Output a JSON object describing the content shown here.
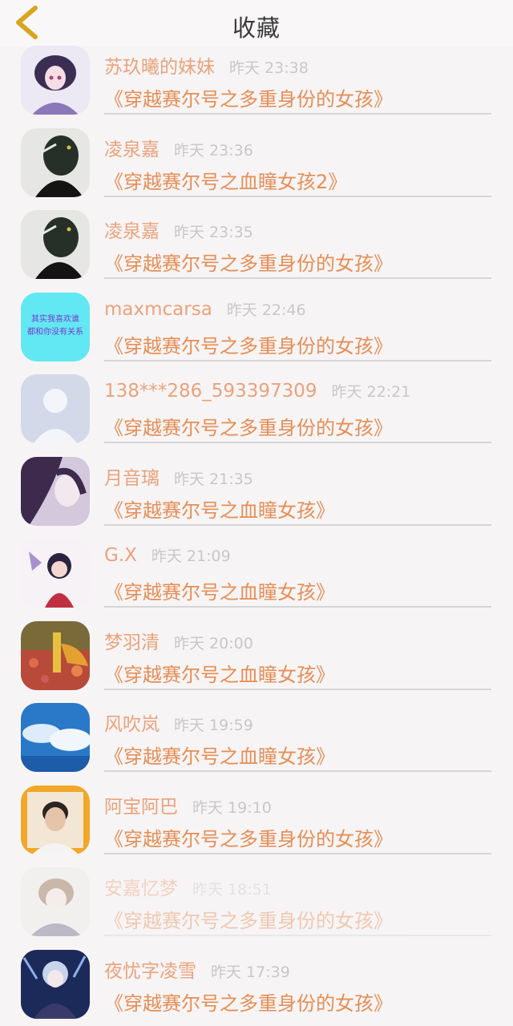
{
  "header": {
    "title": "收藏"
  },
  "items": [
    {
      "name": "苏玖曦的妹妹",
      "time": "昨天 23:38",
      "book": "《穿越赛尔号之多重身份的女孩》"
    },
    {
      "name": "凌泉嘉",
      "time": "昨天 23:36",
      "book": "《穿越赛尔号之血瞳女孩2》"
    },
    {
      "name": "凌泉嘉",
      "time": "昨天 23:35",
      "book": "《穿越赛尔号之多重身份的女孩》"
    },
    {
      "name": "maxmcarsa",
      "time": "昨天 22:46",
      "book": "《穿越赛尔号之多重身份的女孩》",
      "avatar_text": [
        "其实我喜欢谁",
        "都和你没有关系"
      ]
    },
    {
      "name": "138***286_593397309",
      "time": "昨天 22:21",
      "book": "《穿越赛尔号之多重身份的女孩》"
    },
    {
      "name": "月音璃",
      "time": "昨天 21:35",
      "book": "《穿越赛尔号之血瞳女孩》"
    },
    {
      "name": "G.X",
      "time": "昨天 21:09",
      "book": "《穿越赛尔号之血瞳女孩》"
    },
    {
      "name": "梦羽清",
      "time": "昨天 20:00",
      "book": "《穿越赛尔号之血瞳女孩》"
    },
    {
      "name": "风吹岚",
      "time": "昨天 19:59",
      "book": "《穿越赛尔号之血瞳女孩》"
    },
    {
      "name": "阿宝阿巴",
      "time": "昨天 19:10",
      "book": "《穿越赛尔号之多重身份的女孩》"
    },
    {
      "name": "安嘉忆梦",
      "time": "昨天 18:51",
      "book": "《穿越赛尔号之多重身份的女孩》"
    },
    {
      "name": "夜忧字凌雪",
      "time": "昨天 17:39",
      "book": "《穿越赛尔号之多重身份的女孩》"
    }
  ],
  "colors": {
    "accent": "#e58e55",
    "name": "#e9a37c",
    "back_arrow": "#d9a520",
    "time": "#c8c8c8"
  }
}
